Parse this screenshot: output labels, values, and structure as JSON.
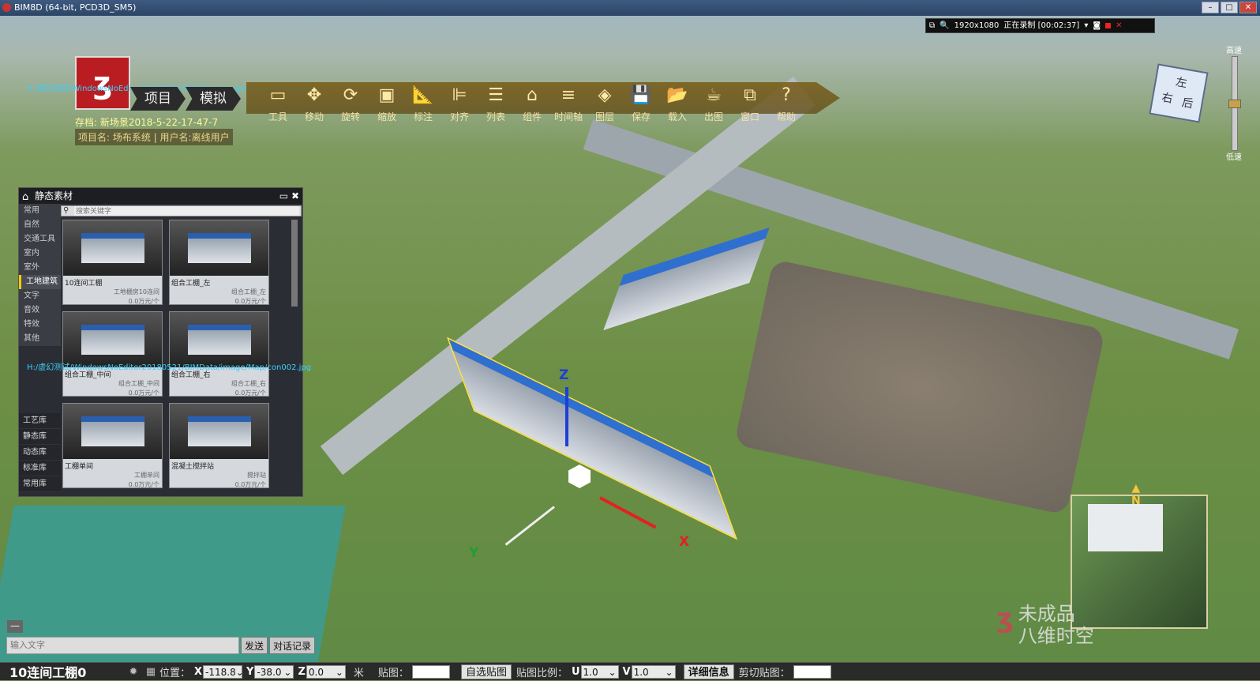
{
  "window": {
    "title": "BIM8D (64-bit, PCD3D_SM5)",
    "controls": [
      "–",
      "□",
      "✕"
    ]
  },
  "recorder": {
    "resolution": "1920x1080",
    "status": "正在录制 [00:02:37]"
  },
  "header": {
    "tabs": [
      "项目",
      "模拟"
    ],
    "path_overlay": "H:/虚幻测试/WindowsNoEditor20180521/BIMData/image/Map/con002.jpg",
    "save_info": "存档: 新场景2018-5-22-17-47-7",
    "project_info": "项目名: 场布系统 | 用户名:离线用户"
  },
  "toolbar": [
    {
      "label": "工具",
      "icon": "tools-icon",
      "glyph": "▭"
    },
    {
      "label": "移动",
      "icon": "move-icon",
      "glyph": "✥"
    },
    {
      "label": "旋转",
      "icon": "rotate-icon",
      "glyph": "⟳"
    },
    {
      "label": "缩放",
      "icon": "scale-icon",
      "glyph": "▣"
    },
    {
      "label": "标注",
      "icon": "ruler-icon",
      "glyph": "📐"
    },
    {
      "label": "对齐",
      "icon": "align-icon",
      "glyph": "⊫"
    },
    {
      "label": "列表",
      "icon": "list-icon",
      "glyph": "☰"
    },
    {
      "label": "组件",
      "icon": "component-icon",
      "glyph": "⌂"
    },
    {
      "label": "时间轴",
      "icon": "timeline-icon",
      "glyph": "≡"
    },
    {
      "label": "图层",
      "icon": "layer-icon",
      "glyph": "◈"
    },
    {
      "label": "保存",
      "icon": "save-icon",
      "glyph": "💾"
    },
    {
      "label": "载入",
      "icon": "load-icon",
      "glyph": "📂"
    },
    {
      "label": "出图",
      "icon": "export-icon",
      "glyph": "☕"
    },
    {
      "label": "窗口",
      "icon": "window-icon",
      "glyph": "⧉"
    },
    {
      "label": "帮助",
      "icon": "help-icon",
      "glyph": "?"
    }
  ],
  "navcube": {
    "faces": [
      "右",
      "后",
      "左"
    ]
  },
  "speed": {
    "high": "高速",
    "low": "低速",
    "level": 0.5
  },
  "panel": {
    "title": "静态素材",
    "search_placeholder": "搜索关键字",
    "categories": [
      "常用",
      "自然",
      "交通工具",
      "室内",
      "室外",
      "工地建筑",
      "文字",
      "音效",
      "特效",
      "其他"
    ],
    "active_category": "工地建筑",
    "libraries": [
      "工艺库",
      "静态库",
      "动态库",
      "标准库",
      "常用库"
    ],
    "items": [
      {
        "name": "10连间工棚",
        "meta": "工地棚房10连间",
        "price": "0.0万元/个"
      },
      {
        "name": "组合工棚_左",
        "meta": "组合工棚_左",
        "price": "0.0万元/个"
      },
      {
        "name": "组合工棚_中间",
        "meta": "组合工棚_中间",
        "price": "0.0万元/个"
      },
      {
        "name": "组合工棚_右",
        "meta": "组合工棚_右",
        "price": "0.0万元/个"
      },
      {
        "name": "工棚单间",
        "meta": "工棚单间",
        "price": "0.0万元/个"
      },
      {
        "name": "混凝土搅拌站",
        "meta": "搅拌站",
        "price": "0.0万元/个"
      }
    ]
  },
  "gizmo": {
    "z": "Z",
    "x": "X",
    "y": "Y"
  },
  "minimap": {
    "north": "N"
  },
  "watermark": {
    "line1": "未成品",
    "line2": "八维时空"
  },
  "chat": {
    "placeholder": "输入文字",
    "send": "发送",
    "history": "对话记录",
    "minimize": "—"
  },
  "status": {
    "object_name": "10连间工棚0",
    "position_label": "位置：",
    "x": "-118.8",
    "y": "-38.0",
    "z": "0.0",
    "unit": "米",
    "texture_label": "贴图：",
    "auto_texture": "自选贴图",
    "ratio_label": "贴图比例：",
    "u": "1.0",
    "v": "1.0",
    "detail": "详细信息",
    "clip_label": "剪切贴图："
  },
  "colors": {
    "accent": "#ffcc00",
    "roof": "#2f6fd0",
    "toolbar": "#7a5a14"
  }
}
